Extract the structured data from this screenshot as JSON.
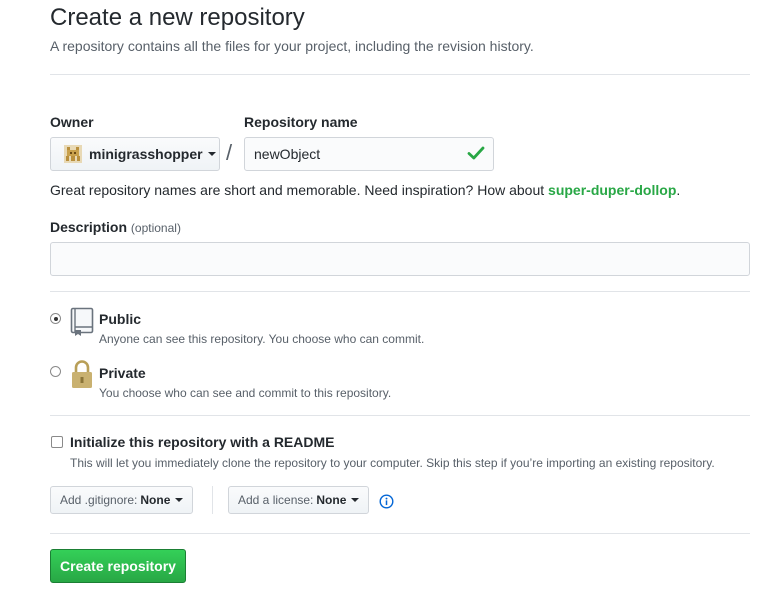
{
  "header": {
    "title": "Create a new repository",
    "subtitle": "A repository contains all the files for your project, including the revision history."
  },
  "owner": {
    "label": "Owner",
    "value": "minigrasshopper"
  },
  "repository_name": {
    "label": "Repository name",
    "value": "newObject",
    "valid": true
  },
  "name_hint": {
    "text": "Great repository names are short and memorable. Need inspiration? How about ",
    "suggestion": "super-duper-dollop",
    "suffix": "."
  },
  "description": {
    "label": "Description",
    "optional_label": "(optional)",
    "value": ""
  },
  "visibility": {
    "selected": "public",
    "public": {
      "title": "Public",
      "note": "Anyone can see this repository. You choose who can commit."
    },
    "private": {
      "title": "Private",
      "note": "You choose who can see and commit to this repository."
    }
  },
  "readme": {
    "checked": false,
    "label": "Initialize this repository with a README",
    "note": "This will let you immediately clone the repository to your computer. Skip this step if you’re importing an existing repository."
  },
  "gitignore": {
    "label": "Add .gitignore:",
    "value": "None"
  },
  "license": {
    "label": "Add a license:",
    "value": "None"
  },
  "create_button": {
    "label": "Create repository"
  },
  "colors": {
    "accent_green": "#28a745",
    "check_green": "#28a745",
    "info_blue": "#0366d6",
    "text": "#24292e",
    "muted": "#586069"
  },
  "icons": {
    "owner_avatar": "pixel-avatar-icon",
    "valid": "check-icon",
    "public": "repo-book-icon",
    "private": "lock-icon",
    "info": "info-icon",
    "dropdown": "caret-down-icon"
  }
}
